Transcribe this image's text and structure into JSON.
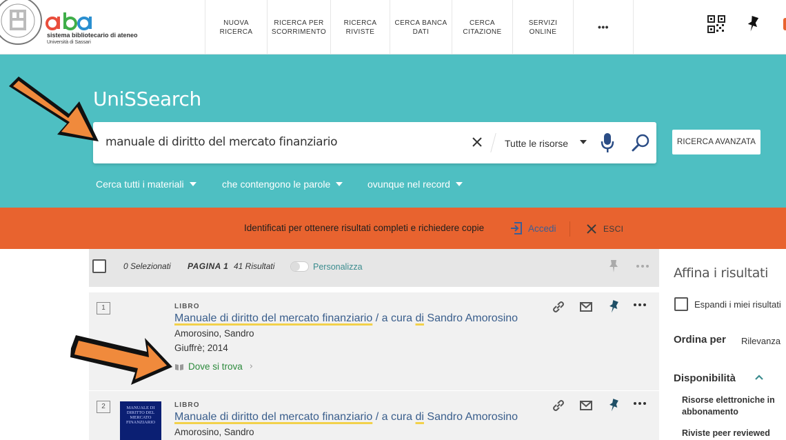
{
  "header": {
    "logo_line1": "sistema bibliotecario di ateneo",
    "logo_line2": "Università di Sassari",
    "nav": [
      {
        "label": "NUOVA\nRICERCA"
      },
      {
        "label": "RICERCA PER\nSCORRIMENTO"
      },
      {
        "label": "RICERCA\nRIVISTE"
      },
      {
        "label": "CERCA BANCA\nDATI"
      },
      {
        "label": "CERCA\nCITAZIONE"
      },
      {
        "label": "SERVIZI\nONLINE"
      },
      {
        "label": "•••"
      }
    ]
  },
  "search": {
    "brand": "UniSSearch",
    "query": "manuale di diritto del mercato finanziario",
    "scope": "Tutte le risorse",
    "advanced_label": "RICERCA AVANZATA",
    "filters": [
      {
        "label": "Cerca tutti i materiali"
      },
      {
        "label": "che contengono le parole"
      },
      {
        "label": "ovunque nel record"
      }
    ]
  },
  "login": {
    "message": "Identificati per ottenere risultati completi e richiedere copie",
    "signin_label": "Accedi",
    "exit_label": "ESCI"
  },
  "results_bar": {
    "selected": "0 Selezionati",
    "page": "PAGINA 1",
    "count": "41 Risultati",
    "personalize": "Personalizza"
  },
  "results": [
    {
      "num": "1",
      "type": "LIBRO",
      "title_parts": [
        "Manuale di diritto del mercato finanziario",
        " / a cura ",
        "di",
        " Sandro Amorosino"
      ],
      "author": "Amorosino, Sandro",
      "publisher": "Giuffrè; 2014",
      "availability": "Dove si trova"
    },
    {
      "num": "2",
      "type": "LIBRO",
      "title_parts": [
        "Manuale di diritto del mercato finanziario",
        " / a cura ",
        "di",
        " Sandro Amorosino"
      ],
      "author": "Amorosino, Sandro",
      "cover_text": "MANUALE DI DIRITTO DEL MERCATO FINANZIARIO"
    }
  ],
  "facets": {
    "title": "Affina i risultati",
    "expand": "Espandi i miei risultati",
    "sort_label": "Ordina per",
    "sort_value": "Rilevanza",
    "availability_title": "Disponibilità",
    "availability_items": [
      {
        "label": "Risorse elettroniche in abbonamento"
      },
      {
        "label": "Riviste peer reviewed"
      }
    ]
  },
  "colors": {
    "teal": "#4ebfc2",
    "orange_band": "#e8632f",
    "link": "#3a5e8c",
    "available": "#2c8a3c",
    "highlight": "#f2d14a",
    "annotation_arrow": "#f08a3c"
  }
}
